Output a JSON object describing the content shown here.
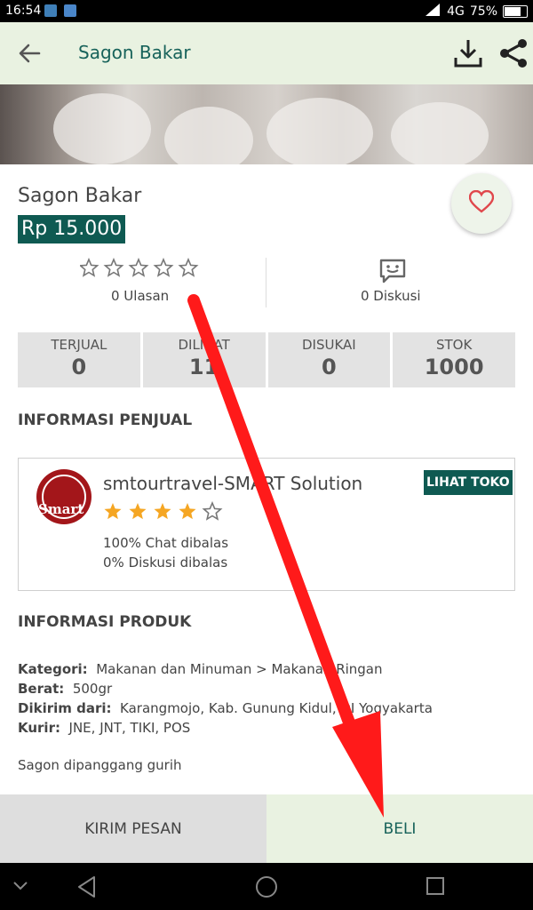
{
  "status_bar": {
    "time": "16:54",
    "network": "4G",
    "battery": "75%",
    "battery_level": 0.75
  },
  "app_bar": {
    "title": "Sagon Bakar"
  },
  "product": {
    "name": "Sagon Bakar",
    "price": "Rp 15.000",
    "reviews_label": "0 Ulasan",
    "rating": 0,
    "discussions_label": "0 Diskusi"
  },
  "stats": [
    {
      "label": "TERJUAL",
      "value": "0"
    },
    {
      "label": "DILIHAT",
      "value": "11"
    },
    {
      "label": "DISUKAI",
      "value": "0"
    },
    {
      "label": "STOK",
      "value": "1000"
    }
  ],
  "seller_section_title": "INFORMASI PENJUAL",
  "seller": {
    "name": "smtourtravel-SMART Solution",
    "logo_text": "Smart",
    "rating": 4,
    "rating_max": 5,
    "chat_rate": "100% Chat dibalas",
    "discussion_rate": "0% Diskusi dibalas",
    "visit_button": "LIHAT TOKO"
  },
  "product_section_title": "INFORMASI PRODUK",
  "product_info": [
    {
      "key": "Kategori:",
      "value": "Makanan dan Minuman > Makanan Ringan"
    },
    {
      "key": "Berat:",
      "value": "500gr"
    },
    {
      "key": "Dikirim dari:",
      "value": "Karangmojo, Kab. Gunung Kidul, DI Yogyakarta"
    },
    {
      "key": "Kurir:",
      "value": "JNE, JNT, TIKI, POS"
    }
  ],
  "description": "Sagon dipanggang gurih",
  "bottom_bar": {
    "message_button": "KIRIM PESAN",
    "buy_button": "BELI"
  },
  "colors": {
    "primary": "#0f5a52",
    "appbar_bg": "#e9f2e1",
    "star": "#f5a623",
    "heart": "#e0474c",
    "annotation_arrow": "#ff1a1a"
  }
}
